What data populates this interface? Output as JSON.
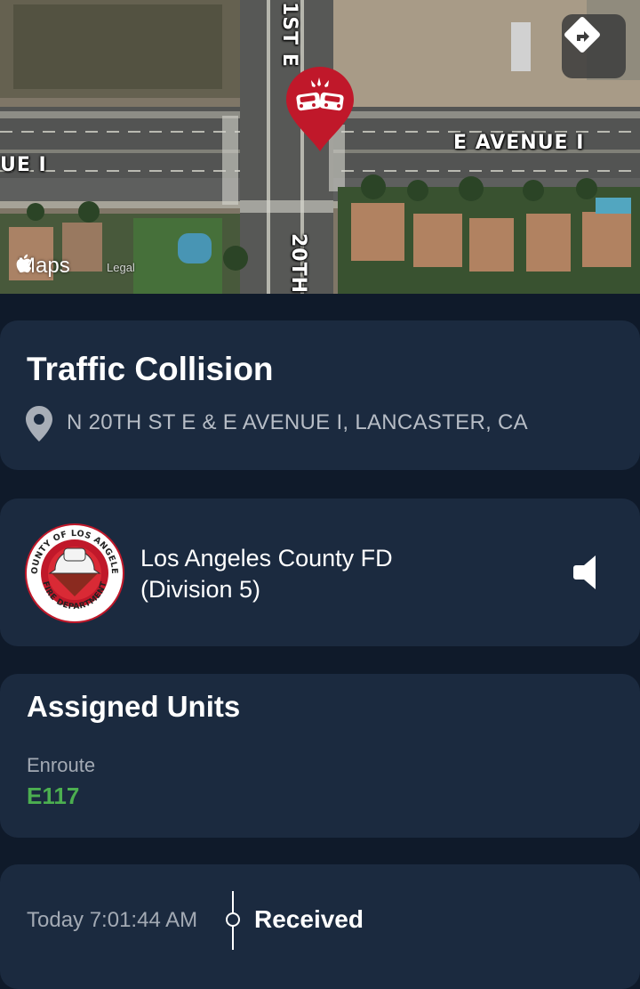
{
  "map": {
    "road_labels": {
      "avenue_right": "E AVENUE I",
      "avenue_left": "UE I",
      "street_top": "1ST E",
      "street_bottom": "20TH"
    },
    "maps_brand": "Maps",
    "legal": "Legal",
    "directions_icon": "directions-turn-icon",
    "pin_icon": "car-collision-icon"
  },
  "incident": {
    "title": "Traffic Collision",
    "address": "N 20TH ST E & E AVENUE I, LANCASTER, CA",
    "address_icon": "location-pin-icon"
  },
  "agency": {
    "name_line1": "Los Angeles County FD",
    "name_line2": "(Division 5)",
    "logo_text_top": "COUNTY OF LOS ANGELES",
    "logo_text_bottom": "FIRE DEPARTMENT",
    "audio_icon": "speaker-icon"
  },
  "units": {
    "title": "Assigned Units",
    "status": "Enroute",
    "unit": "E117"
  },
  "timeline": {
    "time": "Today 7:01:44 AM",
    "event": "Received"
  },
  "colors": {
    "background": "#0f1a2a",
    "card": "#1b2a3f",
    "unit_green": "#4caf50",
    "pin_red": "#c0182a"
  }
}
